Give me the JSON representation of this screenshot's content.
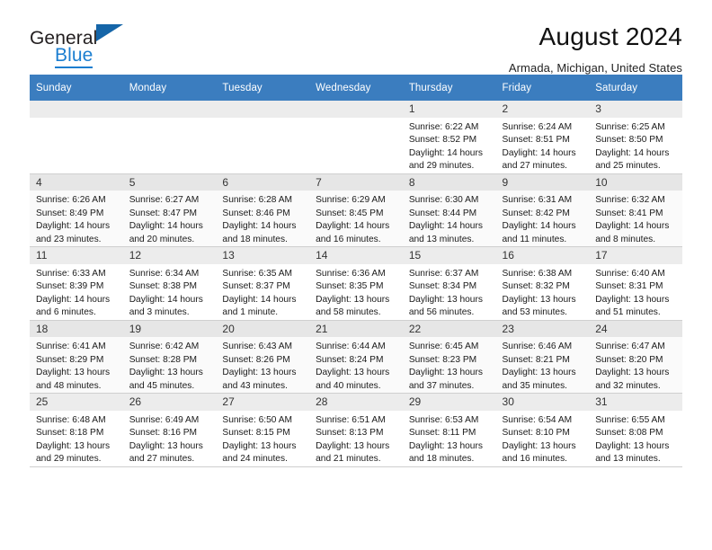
{
  "brand": {
    "name_part1": "General",
    "name_part2": "Blue",
    "triangle_color": "#1565a8",
    "blue_color": "#1b7ed0"
  },
  "header": {
    "title": "August 2024",
    "subtitle": "Armada, Michigan, United States"
  },
  "theme": {
    "header_row_bg": "#3b7dbf",
    "header_row_text": "#ffffff",
    "daynum_bg": "#ececec",
    "alt_row_bg": "#fafafa",
    "grid_line": "#cfcfcf"
  },
  "weekday_headers": [
    "Sunday",
    "Monday",
    "Tuesday",
    "Wednesday",
    "Thursday",
    "Friday",
    "Saturday"
  ],
  "labels": {
    "sunrise_prefix": "Sunrise: ",
    "sunset_prefix": "Sunset: ",
    "daylight_prefix": "Daylight: "
  },
  "weeks": [
    [
      {
        "empty": true
      },
      {
        "empty": true
      },
      {
        "empty": true
      },
      {
        "empty": true
      },
      {
        "day": "1",
        "sunrise": "Sunrise: 6:22 AM",
        "sunset": "Sunset: 8:52 PM",
        "daylight_line1": "Daylight: 14 hours",
        "daylight_line2": "and 29 minutes."
      },
      {
        "day": "2",
        "sunrise": "Sunrise: 6:24 AM",
        "sunset": "Sunset: 8:51 PM",
        "daylight_line1": "Daylight: 14 hours",
        "daylight_line2": "and 27 minutes."
      },
      {
        "day": "3",
        "sunrise": "Sunrise: 6:25 AM",
        "sunset": "Sunset: 8:50 PM",
        "daylight_line1": "Daylight: 14 hours",
        "daylight_line2": "and 25 minutes."
      }
    ],
    [
      {
        "day": "4",
        "sunrise": "Sunrise: 6:26 AM",
        "sunset": "Sunset: 8:49 PM",
        "daylight_line1": "Daylight: 14 hours",
        "daylight_line2": "and 23 minutes."
      },
      {
        "day": "5",
        "sunrise": "Sunrise: 6:27 AM",
        "sunset": "Sunset: 8:47 PM",
        "daylight_line1": "Daylight: 14 hours",
        "daylight_line2": "and 20 minutes."
      },
      {
        "day": "6",
        "sunrise": "Sunrise: 6:28 AM",
        "sunset": "Sunset: 8:46 PM",
        "daylight_line1": "Daylight: 14 hours",
        "daylight_line2": "and 18 minutes."
      },
      {
        "day": "7",
        "sunrise": "Sunrise: 6:29 AM",
        "sunset": "Sunset: 8:45 PM",
        "daylight_line1": "Daylight: 14 hours",
        "daylight_line2": "and 16 minutes."
      },
      {
        "day": "8",
        "sunrise": "Sunrise: 6:30 AM",
        "sunset": "Sunset: 8:44 PM",
        "daylight_line1": "Daylight: 14 hours",
        "daylight_line2": "and 13 minutes."
      },
      {
        "day": "9",
        "sunrise": "Sunrise: 6:31 AM",
        "sunset": "Sunset: 8:42 PM",
        "daylight_line1": "Daylight: 14 hours",
        "daylight_line2": "and 11 minutes."
      },
      {
        "day": "10",
        "sunrise": "Sunrise: 6:32 AM",
        "sunset": "Sunset: 8:41 PM",
        "daylight_line1": "Daylight: 14 hours",
        "daylight_line2": "and 8 minutes."
      }
    ],
    [
      {
        "day": "11",
        "sunrise": "Sunrise: 6:33 AM",
        "sunset": "Sunset: 8:39 PM",
        "daylight_line1": "Daylight: 14 hours",
        "daylight_line2": "and 6 minutes."
      },
      {
        "day": "12",
        "sunrise": "Sunrise: 6:34 AM",
        "sunset": "Sunset: 8:38 PM",
        "daylight_line1": "Daylight: 14 hours",
        "daylight_line2": "and 3 minutes."
      },
      {
        "day": "13",
        "sunrise": "Sunrise: 6:35 AM",
        "sunset": "Sunset: 8:37 PM",
        "daylight_line1": "Daylight: 14 hours",
        "daylight_line2": "and 1 minute."
      },
      {
        "day": "14",
        "sunrise": "Sunrise: 6:36 AM",
        "sunset": "Sunset: 8:35 PM",
        "daylight_line1": "Daylight: 13 hours",
        "daylight_line2": "and 58 minutes."
      },
      {
        "day": "15",
        "sunrise": "Sunrise: 6:37 AM",
        "sunset": "Sunset: 8:34 PM",
        "daylight_line1": "Daylight: 13 hours",
        "daylight_line2": "and 56 minutes."
      },
      {
        "day": "16",
        "sunrise": "Sunrise: 6:38 AM",
        "sunset": "Sunset: 8:32 PM",
        "daylight_line1": "Daylight: 13 hours",
        "daylight_line2": "and 53 minutes."
      },
      {
        "day": "17",
        "sunrise": "Sunrise: 6:40 AM",
        "sunset": "Sunset: 8:31 PM",
        "daylight_line1": "Daylight: 13 hours",
        "daylight_line2": "and 51 minutes."
      }
    ],
    [
      {
        "day": "18",
        "sunrise": "Sunrise: 6:41 AM",
        "sunset": "Sunset: 8:29 PM",
        "daylight_line1": "Daylight: 13 hours",
        "daylight_line2": "and 48 minutes."
      },
      {
        "day": "19",
        "sunrise": "Sunrise: 6:42 AM",
        "sunset": "Sunset: 8:28 PM",
        "daylight_line1": "Daylight: 13 hours",
        "daylight_line2": "and 45 minutes."
      },
      {
        "day": "20",
        "sunrise": "Sunrise: 6:43 AM",
        "sunset": "Sunset: 8:26 PM",
        "daylight_line1": "Daylight: 13 hours",
        "daylight_line2": "and 43 minutes."
      },
      {
        "day": "21",
        "sunrise": "Sunrise: 6:44 AM",
        "sunset": "Sunset: 8:24 PM",
        "daylight_line1": "Daylight: 13 hours",
        "daylight_line2": "and 40 minutes."
      },
      {
        "day": "22",
        "sunrise": "Sunrise: 6:45 AM",
        "sunset": "Sunset: 8:23 PM",
        "daylight_line1": "Daylight: 13 hours",
        "daylight_line2": "and 37 minutes."
      },
      {
        "day": "23",
        "sunrise": "Sunrise: 6:46 AM",
        "sunset": "Sunset: 8:21 PM",
        "daylight_line1": "Daylight: 13 hours",
        "daylight_line2": "and 35 minutes."
      },
      {
        "day": "24",
        "sunrise": "Sunrise: 6:47 AM",
        "sunset": "Sunset: 8:20 PM",
        "daylight_line1": "Daylight: 13 hours",
        "daylight_line2": "and 32 minutes."
      }
    ],
    [
      {
        "day": "25",
        "sunrise": "Sunrise: 6:48 AM",
        "sunset": "Sunset: 8:18 PM",
        "daylight_line1": "Daylight: 13 hours",
        "daylight_line2": "and 29 minutes."
      },
      {
        "day": "26",
        "sunrise": "Sunrise: 6:49 AM",
        "sunset": "Sunset: 8:16 PM",
        "daylight_line1": "Daylight: 13 hours",
        "daylight_line2": "and 27 minutes."
      },
      {
        "day": "27",
        "sunrise": "Sunrise: 6:50 AM",
        "sunset": "Sunset: 8:15 PM",
        "daylight_line1": "Daylight: 13 hours",
        "daylight_line2": "and 24 minutes."
      },
      {
        "day": "28",
        "sunrise": "Sunrise: 6:51 AM",
        "sunset": "Sunset: 8:13 PM",
        "daylight_line1": "Daylight: 13 hours",
        "daylight_line2": "and 21 minutes."
      },
      {
        "day": "29",
        "sunrise": "Sunrise: 6:53 AM",
        "sunset": "Sunset: 8:11 PM",
        "daylight_line1": "Daylight: 13 hours",
        "daylight_line2": "and 18 minutes."
      },
      {
        "day": "30",
        "sunrise": "Sunrise: 6:54 AM",
        "sunset": "Sunset: 8:10 PM",
        "daylight_line1": "Daylight: 13 hours",
        "daylight_line2": "and 16 minutes."
      },
      {
        "day": "31",
        "sunrise": "Sunrise: 6:55 AM",
        "sunset": "Sunset: 8:08 PM",
        "daylight_line1": "Daylight: 13 hours",
        "daylight_line2": "and 13 minutes."
      }
    ]
  ]
}
